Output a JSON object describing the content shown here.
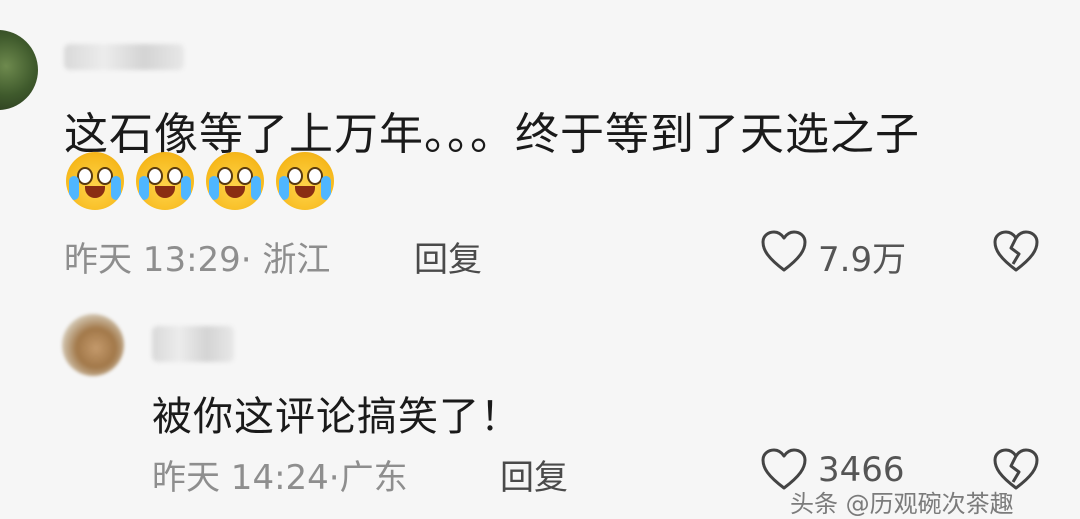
{
  "comment": {
    "text": "这石像等了上万年。。。终于等到了天选之子",
    "emojis": [
      "crying-laugh-emoji",
      "crying-laugh-emoji",
      "crying-laugh-emoji",
      "crying-laugh-emoji"
    ],
    "time": "昨天 13:29",
    "separator": "·",
    "location": "浙江",
    "reply_label": "回复",
    "likes": "7.9万"
  },
  "reply": {
    "text": "被你这评论搞笑了！",
    "time": "昨天 14:24",
    "separator": "·",
    "location": "广东",
    "reply_label": "回复",
    "likes": "3466"
  },
  "watermark": "头条 @历观碗次茶趣"
}
